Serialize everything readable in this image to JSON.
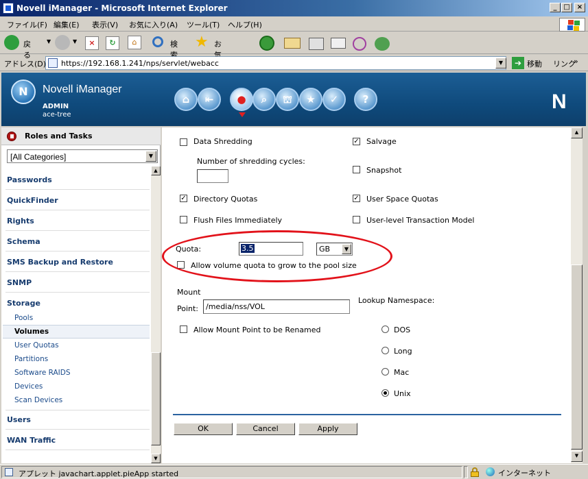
{
  "window": {
    "title": "Novell iManager - Microsoft Internet Explorer",
    "min_label": "_",
    "max_label": "□",
    "close_label": "×"
  },
  "menu": [
    "ファイル(F)",
    "編集(E)",
    "表示(V)",
    "お気に入り(A)",
    "ツール(T)",
    "ヘルプ(H)"
  ],
  "toolbar": {
    "back_label": "戻る",
    "search_label": "検索",
    "favorites_label": "お気に入り"
  },
  "address": {
    "label": "アドレス(D)",
    "url": "https://192.168.1.241/nps/servlet/webacc",
    "go_label": "移動",
    "links_label": "リンク"
  },
  "imanager": {
    "product": "Novell iManager",
    "user": "ADMIN",
    "tree": "ace-tree",
    "nav_icons": [
      "home-icon",
      "exit-icon",
      "roles-tasks-icon",
      "view-objects-icon",
      "configure-icon",
      "favorites-icon",
      "preferences-icon",
      "help-icon"
    ],
    "brand_letter": "N"
  },
  "left": {
    "header": "Roles and Tasks",
    "category_selected": "[All Categories]",
    "categories": [
      {
        "label": "Passwords"
      },
      {
        "label": "QuickFinder"
      },
      {
        "label": "Rights"
      },
      {
        "label": "Schema"
      },
      {
        "label": "SMS Backup and Restore"
      },
      {
        "label": "SNMP"
      },
      {
        "label": "Storage"
      }
    ],
    "storage_items": [
      "Pools",
      "Volumes",
      "User Quotas",
      "Partitions",
      "Software RAIDS",
      "Devices",
      "Scan Devices"
    ],
    "active_item": "Volumes",
    "after_categories": [
      "Users",
      "WAN Traffic"
    ]
  },
  "form": {
    "data_shredding": {
      "label": "Data Shredding",
      "checked": false
    },
    "shredding_cycles_label": "Number of shredding cycles:",
    "shredding_cycles_value": "",
    "salvage": {
      "label": "Salvage",
      "checked": true
    },
    "snapshot": {
      "label": "Snapshot",
      "checked": false
    },
    "directory_quotas": {
      "label": "Directory Quotas",
      "checked": true
    },
    "user_space_quotas": {
      "label": "User Space Quotas",
      "checked": true
    },
    "flush_files": {
      "label": "Flush Files Immediately",
      "checked": false
    },
    "user_level_txn": {
      "label": "User-level Transaction Model",
      "checked": false
    },
    "quota_label": "Quota:",
    "quota_value": "3.5",
    "quota_unit": "GB",
    "allow_grow": {
      "label": "Allow volume quota to grow to the pool size",
      "checked": false
    },
    "mount_label": "Mount",
    "point_label": "Point:",
    "mount_point_value": "/media/nss/VOL",
    "lookup_label": "Lookup Namespace:",
    "allow_rename": {
      "label": "Allow Mount Point to be Renamed",
      "checked": false
    },
    "namespaces": [
      {
        "label": "DOS",
        "selected": false
      },
      {
        "label": "Long",
        "selected": false
      },
      {
        "label": "Mac",
        "selected": false
      },
      {
        "label": "Unix",
        "selected": true
      }
    ],
    "ok_label": "OK",
    "cancel_label": "Cancel",
    "apply_label": "Apply"
  },
  "status": {
    "text": "アプレット javachart.applet.pieApp started",
    "zone": "インターネット"
  },
  "colors": {
    "highlight_ellipse": "#e2121a",
    "header_blue": "#0f4a7c",
    "link_blue": "#1a4a8a"
  }
}
